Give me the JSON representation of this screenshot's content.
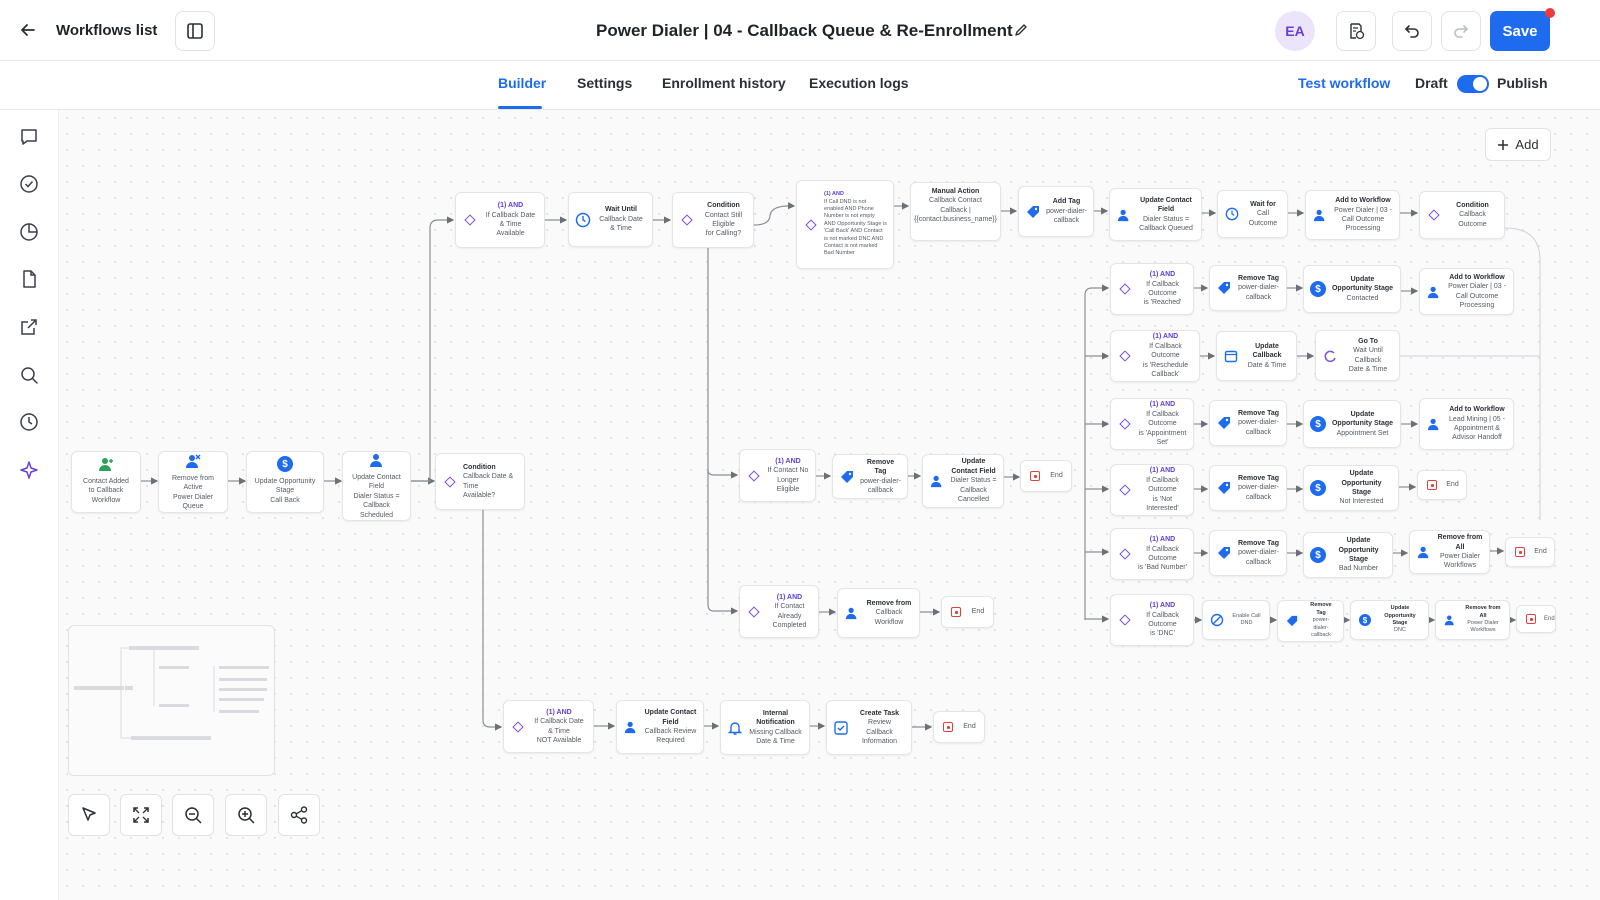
{
  "header": {
    "back_label": "Workflows list",
    "title": "Power Dialer | 04 - Callback Queue & Re-Enrollment",
    "avatar_initials": "EA",
    "save_label": "Save"
  },
  "tabs": [
    "Builder",
    "Settings",
    "Enrollment history",
    "Execution logs"
  ],
  "active_tab": "Builder",
  "right_controls": {
    "test_label": "Test workflow",
    "draft_label": "Draft",
    "publish_label": "Publish"
  },
  "canvas": {
    "add_label": "Add"
  },
  "colors": {
    "accent": "#1e6bf0",
    "condition": "#7a4ee8",
    "end": "#e0413a",
    "avatar_bg": "#ece4fb",
    "avatar_fg": "#6a3fd3"
  },
  "sidebar_icons": [
    "chat-icon",
    "check-circle-icon",
    "pie-chart-icon",
    "document-icon",
    "external-link-icon",
    "search-icon",
    "history-icon",
    "ai-sparkle-icon"
  ],
  "nodes": {
    "n1": {
      "l1": "Contact Added",
      "l2": "to Callback Workflow"
    },
    "n2": {
      "l1": "Remove from Active",
      "l2": "Power Dialer Queue"
    },
    "n3": {
      "l1": "Update Opportunity Stage",
      "l2": "Call Back"
    },
    "n4": {
      "l1": "Update Contact Field",
      "l2": "Dialer Status =",
      "l3": "Callback Scheduled"
    },
    "c1": {
      "l1": "Condition",
      "l2": "Callback Date & Time",
      "l3": "Available?"
    },
    "a1": {
      "l1": "(1) AND",
      "l2": "If Callback Date & Time",
      "l3": "Available"
    },
    "w1": {
      "l1": "Wait Until",
      "l2": "Callback Date & Time"
    },
    "c2": {
      "l1": "Condition",
      "l2": "Contact Still Eligible",
      "l3": "for Calling?"
    },
    "a2": {
      "l1": "(1) AND",
      "l2": "If Call DND is not enabled AND Phone Number is not empty AND Opportunity Stage is 'Call Back' AND Contact is not marked DNC AND Contact is not marked Bad Number"
    },
    "m1": {
      "l1": "Manual Action",
      "l2": "Callback Contact",
      "l3": "Callback | {{contact.business_name}}"
    },
    "t1": {
      "l1": "Add Tag",
      "l2": "power-dialer-callback"
    },
    "u1": {
      "l1": "Update Contact Field",
      "l2": "Dialer Status =",
      "l3": "Callback Queued"
    },
    "w2": {
      "l1": "Wait for",
      "l2": "Call Outcome"
    },
    "aw1": {
      "l1": "Add to Workflow",
      "l2": "Power Dialer | 03 -",
      "l3": "Call Outcome Processing"
    },
    "c3": {
      "l1": "Condition",
      "l2": "Callback Outcome"
    },
    "r1": {
      "l1": "(1) AND",
      "l2": "If Callback Outcome",
      "l3": "is 'Reached'"
    },
    "r1a": {
      "l1": "Remove Tag",
      "l2": "power-dialer-callback"
    },
    "r1b": {
      "l1": "Update Opportunity Stage",
      "l2": "Contacted"
    },
    "r1c": {
      "l1": "Add to Workflow",
      "l2": "Power Dialer | 03 -",
      "l3": "Call Outcome Processing"
    },
    "r2": {
      "l1": "(1) AND",
      "l2": "If Callback Outcome",
      "l3": "is 'Reschedule Callback'"
    },
    "r2a": {
      "l1": "Update Callback",
      "l2": "Date & Time"
    },
    "r2b": {
      "l1": "Go To",
      "l2": "Wait Until Callback",
      "l3": "Date & Time"
    },
    "r3": {
      "l1": "(1) AND",
      "l2": "If Callback Outcome",
      "l3": "is 'Appointment Set'"
    },
    "r3a": {
      "l1": "Remove Tag",
      "l2": "power-dialer-callback"
    },
    "r3b": {
      "l1": "Update Opportunity Stage",
      "l2": "Appointment Set"
    },
    "r3c": {
      "l1": "Add to Workflow",
      "l2": "Lead Mining | 05 -",
      "l3": "Appointment & Advisor Handoff"
    },
    "r4": {
      "l1": "(1) AND",
      "l2": "If Callback Outcome",
      "l3": "is 'Not Interested'"
    },
    "r4a": {
      "l1": "Remove Tag",
      "l2": "power-dialer-callback"
    },
    "r4b": {
      "l1": "Update Opportunity Stage",
      "l2": "Not Interested"
    },
    "r5": {
      "l1": "(1) AND",
      "l2": "If Callback Outcome",
      "l3": "is 'Bad Number'"
    },
    "r5a": {
      "l1": "Remove Tag",
      "l2": "power-dialer-callback"
    },
    "r5b": {
      "l1": "Update Opportunity Stage",
      "l2": "Bad Number"
    },
    "r5c": {
      "l1": "Remove from All",
      "l2": "Power Dialer Workflows"
    },
    "r6": {
      "l1": "(1) AND",
      "l2": "If Callback Outcome",
      "l3": "is 'DNC'"
    },
    "r6a": {
      "l1": "Enable Call DND"
    },
    "r6b": {
      "l1": "Remove Tag",
      "l2": "power-dialer-callback"
    },
    "r6c": {
      "l1": "Update Opportunity Stage",
      "l2": "DNC"
    },
    "r6d": {
      "l1": "Remove from All",
      "l2": "Power Dialer Workflows"
    },
    "e1": {
      "l1": "(1) AND",
      "l2": "If Contact No",
      "l3": "Longer Eligible"
    },
    "e1a": {
      "l1": "Remove Tag",
      "l2": "power-dialer-callback"
    },
    "e1b": {
      "l1": "Update Contact Field",
      "l2": "Dialer Status =",
      "l3": "Callback Cancelled"
    },
    "k1": {
      "l1": "(1) AND",
      "l2": "If Contact Already",
      "l3": "Completed"
    },
    "k1a": {
      "l1": "Remove from",
      "l2": "Callback Workflow"
    },
    "n5": {
      "l1": "(1) AND",
      "l2": "If Callback Date & Time",
      "l3": "NOT Available"
    },
    "n5a": {
      "l1": "Update Contact Field",
      "l2": "Callback Review",
      "l3": "Required"
    },
    "n5b": {
      "l1": "Internal Notification",
      "l2": "Missing Callback",
      "l3": "Date & Time"
    },
    "n5c": {
      "l1": "Create Task",
      "l2": "Review Callback",
      "l3": "Information"
    },
    "end": {
      "l1": "End"
    }
  }
}
